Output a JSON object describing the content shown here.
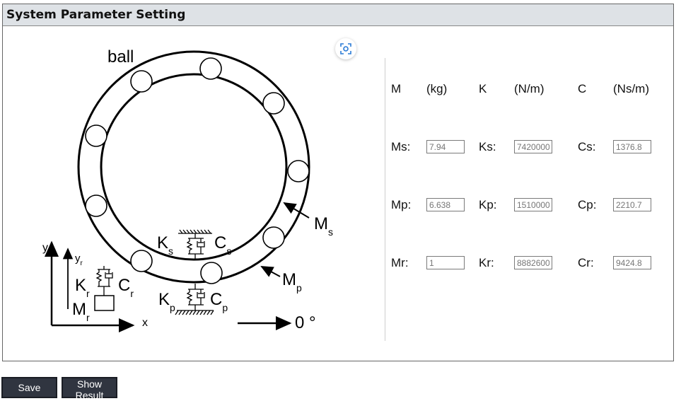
{
  "panel": {
    "title": "System Parameter Setting"
  },
  "diagram": {
    "ball_label": "ball",
    "ms_label": "M",
    "ms_sub": "s",
    "mp_label": "M",
    "mp_sub": "p",
    "ks_label": "K",
    "ks_sub": "s",
    "cs_label": "C",
    "cs_sub": "s",
    "kp_label": "K",
    "kp_sub": "p",
    "cp_label": "C",
    "cp_sub": "p",
    "kr_label": "K",
    "kr_sub": "r",
    "cr_label": "C",
    "cr_sub": "r",
    "mr_label": "M",
    "mr_sub": "r",
    "y_label": "y",
    "yr_label": "y",
    "yr_sub": "r",
    "x_label": "x",
    "angle_label": "0 °"
  },
  "params": {
    "headers": [
      "M",
      "(kg)",
      "K",
      "(N/m)",
      "C",
      "(Ns/m)"
    ],
    "rows": [
      {
        "m_label": "Ms:",
        "m_value": "7.94",
        "k_label": "Ks:",
        "k_value": "7420000",
        "c_label": "Cs:",
        "c_value": "1376.8"
      },
      {
        "m_label": "Mp:",
        "m_value": "6.638",
        "k_label": "Kp:",
        "k_value": "1510000",
        "c_label": "Cp:",
        "c_value": "2210.7"
      },
      {
        "m_label": "Mr:",
        "m_value": "1",
        "k_label": "Kr:",
        "k_value": "8882600",
        "c_label": "Cr:",
        "c_value": "9424.8"
      }
    ]
  },
  "buttons": {
    "save": "Save",
    "show_result": "Show Result"
  }
}
